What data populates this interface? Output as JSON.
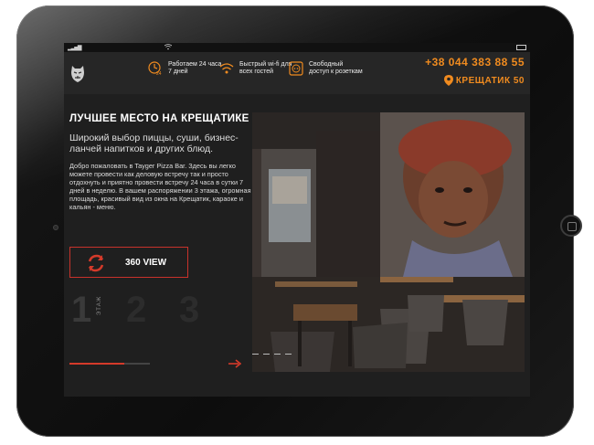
{
  "status": {
    "wifi": "wifi-icon"
  },
  "header": {
    "logo": "tiger-logo-icon",
    "features": [
      {
        "icon": "clock-24-icon",
        "text": "Работаем 24 часа 7 дней"
      },
      {
        "icon": "wifi-icon",
        "text": "Быстрый wi-fi для всех гостей"
      },
      {
        "icon": "socket-icon",
        "text": "Свободный доступ к розеткам"
      }
    ],
    "phone": "+38 044 383 88 55",
    "address": "КРЕЩАТИК 50"
  },
  "main": {
    "title": "ЛУЧШЕЕ МЕСТО НА КРЕЩАТИКЕ",
    "subtitle": "Широкий выбор пиццы, суши, бизнес-ланчей напитков и других блюд.",
    "body": "Добро пожаловать в Tayger Pizza Bar. Здесь вы легко можете провести как деловую встречу так и просто отдохнуть и приятно провести встречу 24 часа в сутки 7 дней в неделю. В вашем распоряжении 3 этажа, огромная площадь, красивый вид из окна на Крещатик, караоке и кальян - меню.",
    "view_button": "360 VIEW",
    "floors": [
      "1",
      "2",
      "3"
    ],
    "floor_label": "ЭТАЖ",
    "active_floor": 1
  },
  "colors": {
    "accent": "#f08b1f",
    "red": "#d43a2a",
    "bg": "#1f1f1f"
  }
}
